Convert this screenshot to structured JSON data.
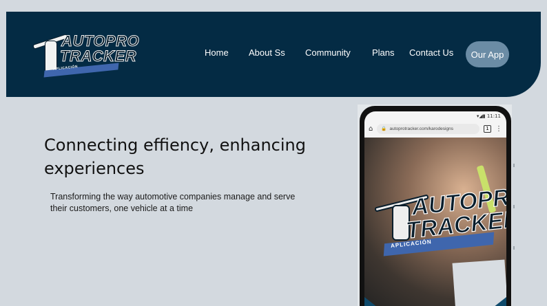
{
  "brand": {
    "logo_line1": "AUTOPRO",
    "logo_line2": "TRACKER",
    "logo_tagline": "APLICACIÓN"
  },
  "nav": {
    "items": [
      {
        "label": "Home"
      },
      {
        "label": "About Ss"
      },
      {
        "label": "Community"
      },
      {
        "label": "Plans"
      },
      {
        "label": "Contact Us"
      }
    ],
    "cta_label": "Our App"
  },
  "hero": {
    "headline": "Connecting effiency, enhancing experiences",
    "subtext": "Transforming the way automotive companies manage and serve their customers, one vehicle at a time"
  },
  "phone": {
    "status_time": "11:11",
    "url": "autoprotracker.com/karodesigns",
    "tab_count": "1",
    "app_logo_line1": "AUTOPRO",
    "app_logo_line2": "TRACKER",
    "app_tagline": "APLICACIÓN"
  },
  "colors": {
    "page_bg": "#d3d9df",
    "nav_bg": "#042b44",
    "cta_bg": "#6b8ca5",
    "brand_blue": "#3f66ad"
  },
  "icons": [
    "home-icon",
    "lock-icon",
    "menu-kebab-icon",
    "tabs-icon",
    "wrench-icon",
    "signal-icon",
    "battery-icon"
  ]
}
